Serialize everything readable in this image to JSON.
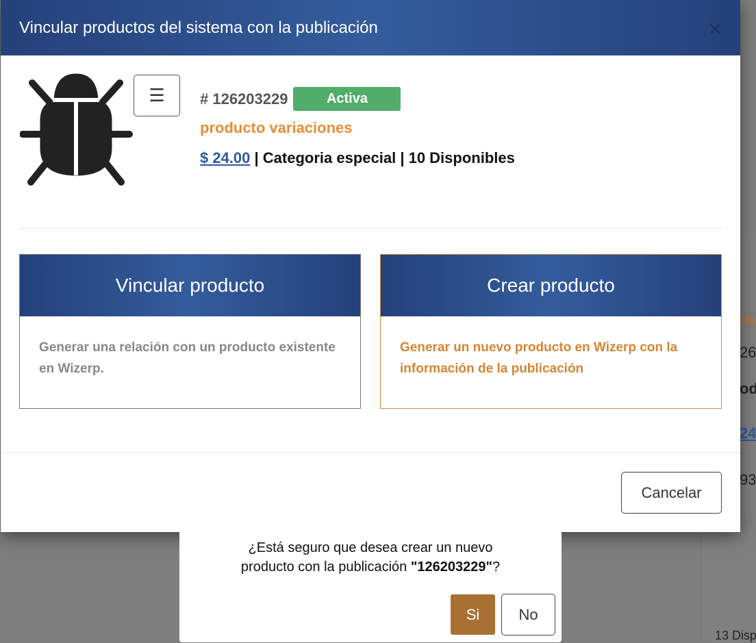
{
  "background": {
    "fragments": [
      "du",
      "26",
      "odu",
      "24",
      "93",
      "13 Disp"
    ]
  },
  "modal": {
    "title": "Vincular productos del sistema con la publicación",
    "close": "×",
    "product": {
      "id": "# 126203229",
      "status": "Activa",
      "name": "producto variaciones",
      "price": "$ 24.00",
      "details": " | Categoria especial | 10 Disponibles"
    },
    "cards": [
      {
        "title": "Vincular producto",
        "desc": "Generar una relación con un producto existente en Wizerp."
      },
      {
        "title": "Crear producto",
        "desc": "Generar un nuevo producto en Wizerp con la información de la publicación"
      }
    ],
    "cancel": "Cancelar"
  },
  "confirm": {
    "message_line1": "¿Está seguro que desea crear un nuevo",
    "message_line2": "producto con la publicación ",
    "message_id": "\"126203229\"",
    "message_end": "?",
    "yes": "Si",
    "no": "No"
  },
  "colors": {
    "header": "#25417a",
    "accent": "#e88e36",
    "active": "#52ad6a",
    "yes": "#a97132"
  }
}
